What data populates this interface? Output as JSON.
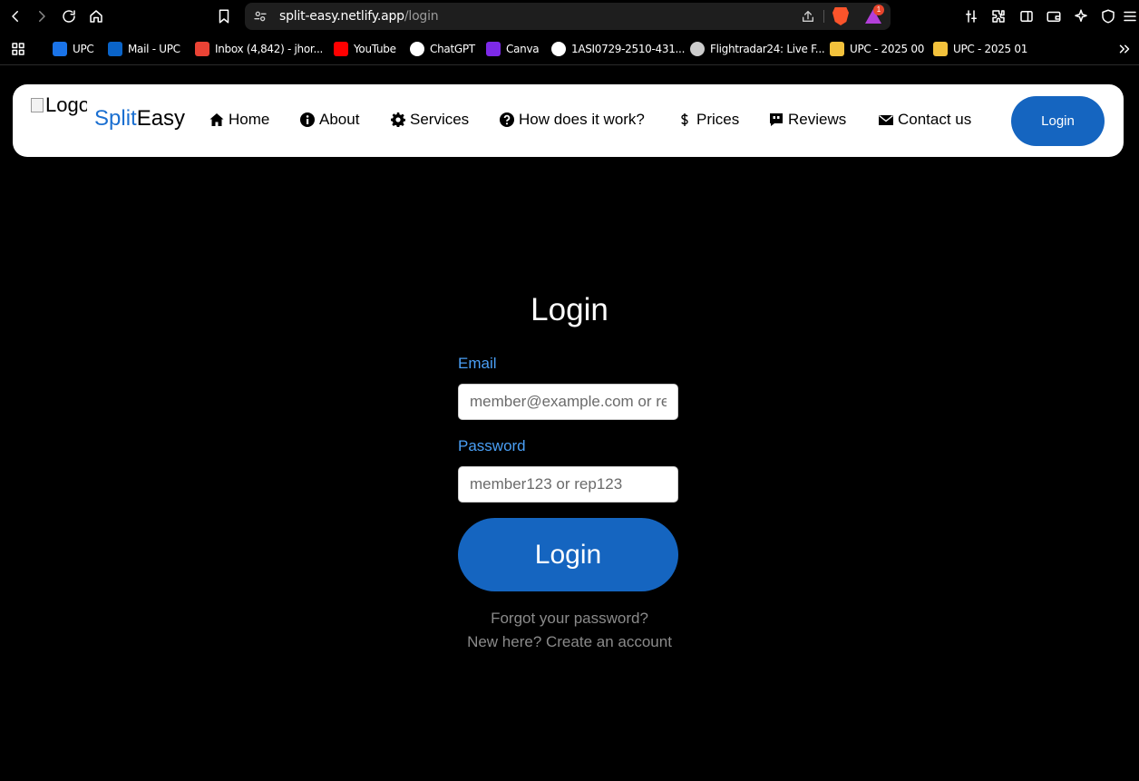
{
  "browser": {
    "url_host": "split-easy.netlify.app",
    "url_path": "/login",
    "rewards_badge": "1",
    "bookmarks": [
      {
        "label": "UPC",
        "icon": "upc-icon",
        "color": "#1a73e8"
      },
      {
        "label": "Mail - UPC",
        "icon": "outlook-icon",
        "color": "#0a64c9"
      },
      {
        "label": "Inbox (4,842) - jhor...",
        "icon": "gmail-icon",
        "color": "#ea4335"
      },
      {
        "label": "YouTube",
        "icon": "youtube-icon",
        "color": "#ff0000"
      },
      {
        "label": "ChatGPT",
        "icon": "chatgpt-icon",
        "color": "#ffffff"
      },
      {
        "label": "Canva",
        "icon": "canva-icon",
        "color": "#7d2ae8"
      },
      {
        "label": "1ASI0729-2510-431...",
        "icon": "github-icon",
        "color": "#ffffff"
      },
      {
        "label": "Flightradar24: Live F...",
        "icon": "flightradar-icon",
        "color": "#cccccc"
      },
      {
        "label": "UPC - 2025 00",
        "icon": "folder-icon",
        "color": "#f3c23c"
      },
      {
        "label": "UPC - 2025 01",
        "icon": "folder-icon",
        "color": "#f3c23c"
      }
    ]
  },
  "site": {
    "logo_alt": "Logo",
    "brand_part1": "Split",
    "brand_part2": "Easy",
    "nav": [
      {
        "label": "Home",
        "icon": "home-icon"
      },
      {
        "label": "About",
        "icon": "info-icon"
      },
      {
        "label": "Services",
        "icon": "gear-icon"
      },
      {
        "label": "How does it work?",
        "icon": "question-icon"
      },
      {
        "label": "Prices",
        "icon": "dollar-icon"
      },
      {
        "label": "Reviews",
        "icon": "quote-icon"
      },
      {
        "label": "Contact us",
        "icon": "envelope-icon"
      }
    ],
    "nav_login": "Login"
  },
  "form": {
    "title": "Login",
    "email_label": "Email",
    "email_placeholder": "member@example.com or rep@example.com",
    "password_label": "Password",
    "password_placeholder": "member123 or rep123",
    "submit": "Login",
    "forgot": "Forgot your password?",
    "signup": "New here? Create an account"
  },
  "colors": {
    "accent": "#1565c0",
    "label": "#4a9ff5",
    "brand_split": "#1a6fd1"
  }
}
